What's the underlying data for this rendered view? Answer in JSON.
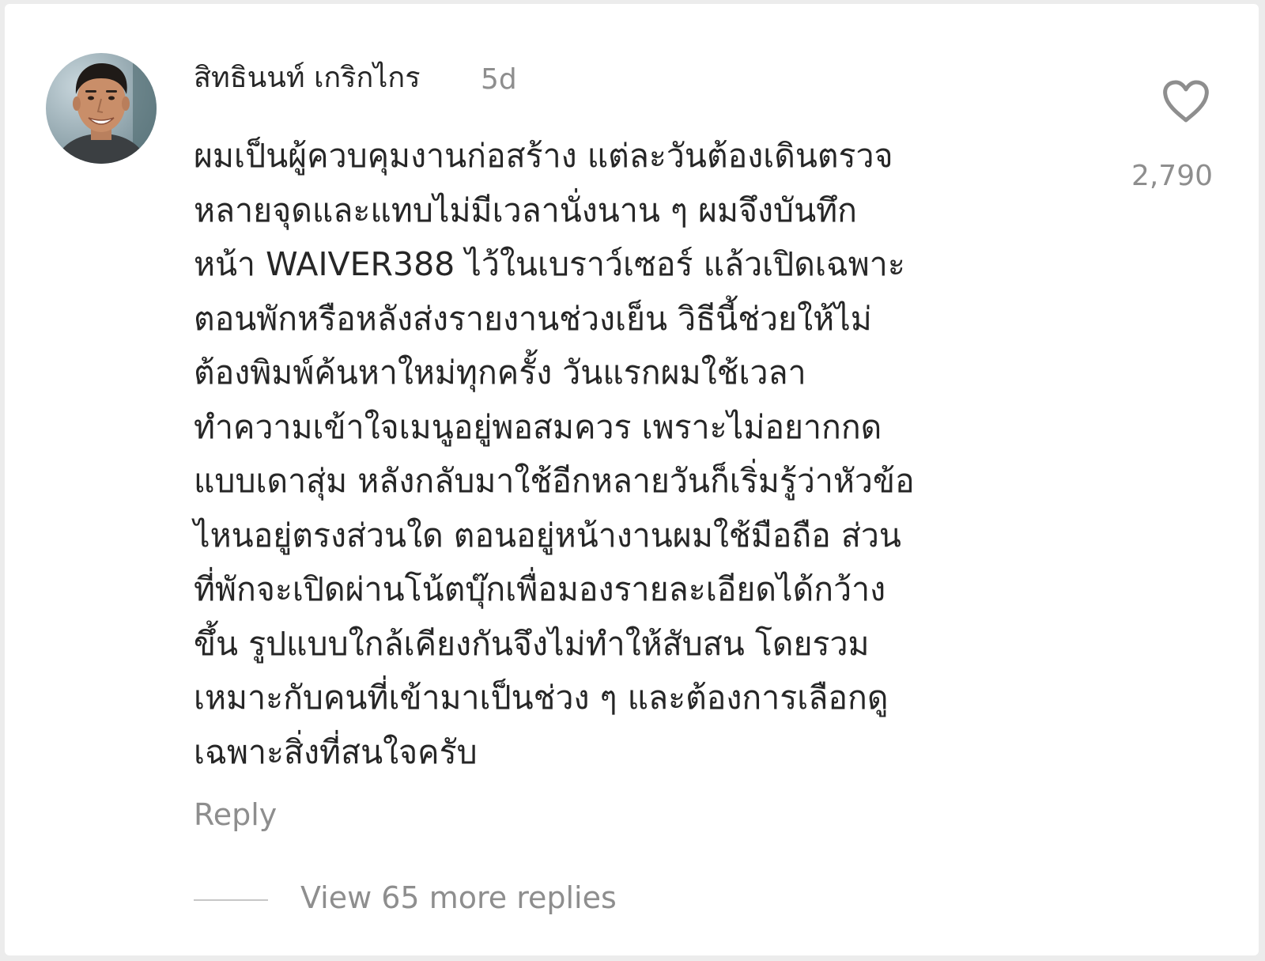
{
  "comment": {
    "username": "สิทธินนท์ เกริกไกร",
    "timestamp": "5d",
    "avatar_icon": "user-avatar-photo",
    "body_lines": [
      "ผมเป็นผู้ควบคุมงานก่อสร้าง แต่ละวันต้องเดินตรวจ",
      "หลายจุดและแทบไม่มีเวลานั่งนาน ๆ ผมจึงบันทึก",
      "หน้า WAIVER388 ไว้ในเบราว์เซอร์ แล้วเปิดเฉพาะ",
      "ตอนพักหรือหลังส่งรายงานช่วงเย็น วิธีนี้ช่วยให้ไม่",
      "ต้องพิมพ์ค้นหาใหม่ทุกครั้ง วันแรกผมใช้เวลา",
      "ทำความเข้าใจเมนูอยู่พอสมควร เพราะไม่อยากกด",
      "แบบเดาสุ่ม หลังกลับมาใช้อีกหลายวันก็เริ่มรู้ว่าหัวข้อ",
      "ไหนอยู่ตรงส่วนใด ตอนอยู่หน้างานผมใช้มือถือ ส่วน",
      "ที่พักจะเปิดผ่านโน้ตบุ๊กเพื่อมองรายละเอียดได้กว้าง",
      "ขึ้น รูปแบบใกล้เคียงกันจึงไม่ทำให้สับสน โดยรวม",
      "เหมาะกับคนที่เข้ามาเป็นช่วง ๆ และต้องการเลือกดู",
      "เฉพาะสิ่งที่สนใจครับ"
    ],
    "like_icon": "heart-outline-icon",
    "like_count": "2,790",
    "reply_label": "Reply",
    "view_replies_label": "View 65 more replies"
  },
  "colors": {
    "primary_text": "#262626",
    "secondary_text": "#8e8e8e",
    "divider": "#c7c7c7",
    "background": "#ffffff"
  }
}
